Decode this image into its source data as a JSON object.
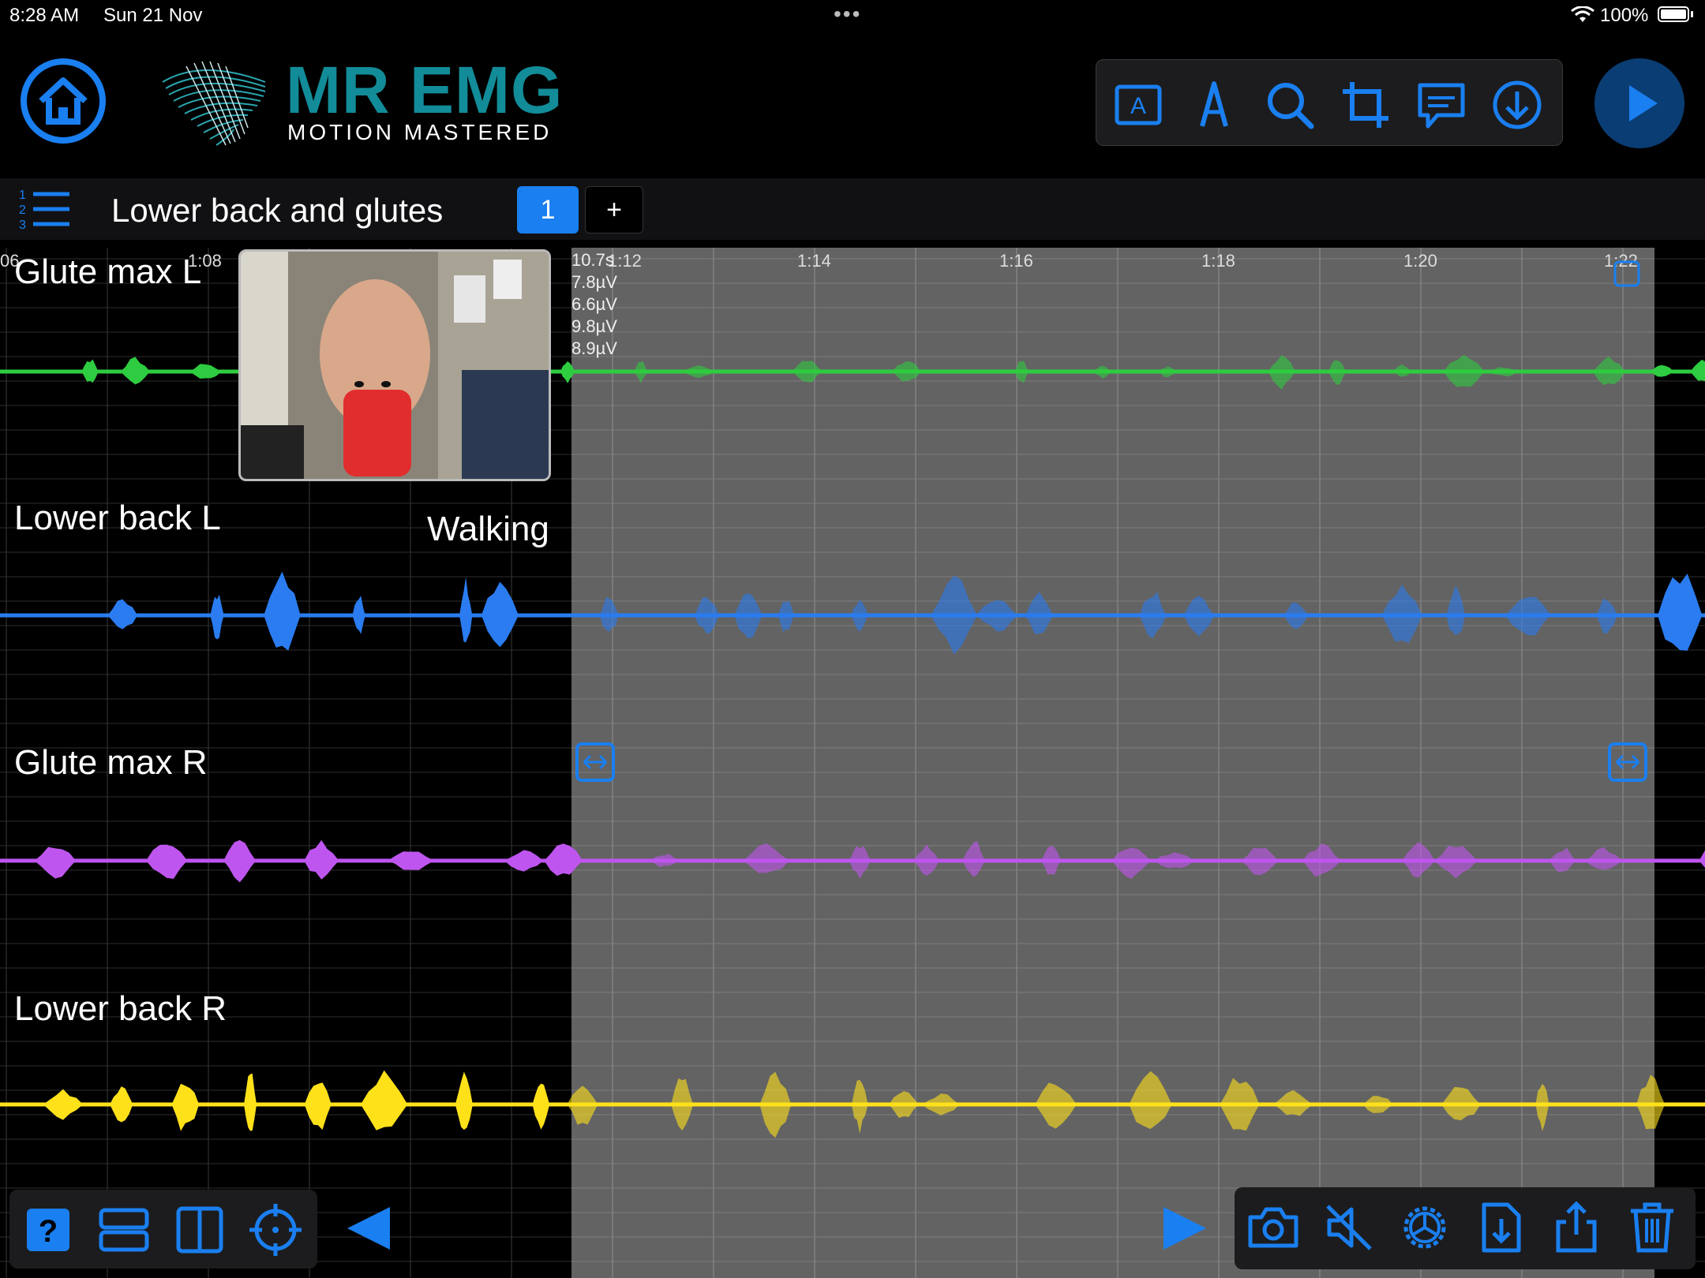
{
  "status_bar": {
    "time": "8:28 AM",
    "date": "Sun 21 Nov",
    "battery": "100%"
  },
  "app": {
    "logo_title": "MR EMG",
    "logo_subtitle": "MOTION MASTERED"
  },
  "toolbar_icons": [
    "text-annotation-icon",
    "pen-icon",
    "search-icon",
    "crop-icon",
    "comment-icon",
    "download-icon"
  ],
  "session": {
    "title": "Lower back and glutes",
    "tabs": [
      "1"
    ],
    "add_label": "+"
  },
  "timeline": {
    "ticks": [
      "06",
      "1:08",
      "1:12",
      "1:14",
      "1:16",
      "1:18",
      "1:20",
      "1:22"
    ],
    "duration": "10.7s",
    "readouts": [
      "7.8µV",
      "6.6µV",
      "9.8µV",
      "8.9µV"
    ]
  },
  "event_label": "Walking",
  "colors": {
    "accent": "#1a7ff0",
    "brand": "#128c98",
    "selection": "#6b6b6b"
  },
  "chart_data": {
    "type": "line",
    "x_axis": "time",
    "series": [
      {
        "name": "Glute max L",
        "color": "#2ecc40"
      },
      {
        "name": "Lower back L",
        "color": "#2a7cf0"
      },
      {
        "name": "Glute max R",
        "color": "#bf55ef"
      },
      {
        "name": "Lower back R",
        "color": "#ffe11a"
      }
    ]
  }
}
